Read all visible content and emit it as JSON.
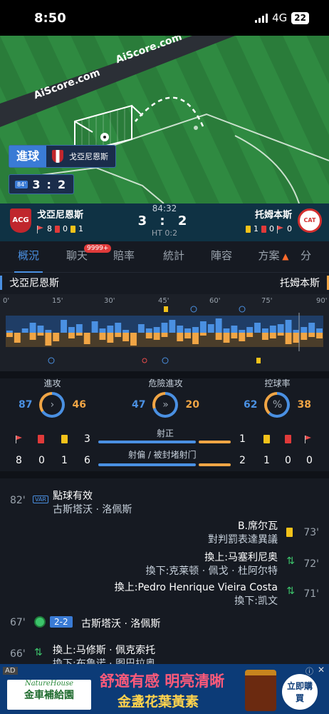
{
  "status_bar": {
    "time": "8:50",
    "network": "4G",
    "battery": "22"
  },
  "pitch": {
    "watermark": "AiScore.com",
    "goal_label": "進球",
    "goal_team": "戈亞尼恩斯",
    "minute_badge": "84'",
    "score_home": "3",
    "score_away": "2"
  },
  "match": {
    "home": {
      "name": "戈亞尼恩斯",
      "corners": "8",
      "reds": "0",
      "yellows": "1"
    },
    "away": {
      "name": "托姆本斯",
      "yellows": "1",
      "reds": "0",
      "corners": "0"
    },
    "clock": "84:32",
    "score": "3 : 2",
    "half_time": "HT 0:2"
  },
  "tabs": [
    {
      "label": "概況",
      "active": true
    },
    {
      "label": "聊天",
      "badge": "9999+"
    },
    {
      "label": "賠率"
    },
    {
      "label": "統計"
    },
    {
      "label": "陣容"
    },
    {
      "label": "方案"
    },
    {
      "label": "分"
    }
  ],
  "timeline": {
    "home_team": "戈亞尼恩斯",
    "away_team": "托姆本斯",
    "ticks": [
      "0'",
      "15'",
      "30'",
      "45'",
      "60'",
      "75'",
      "90'"
    ]
  },
  "stats": {
    "attack": {
      "label": "進攻",
      "home": "87",
      "away": "46"
    },
    "dangerous": {
      "label": "危險進攻",
      "home": "47",
      "away": "20"
    },
    "possession": {
      "label": "控球率",
      "home": "62",
      "away": "38",
      "symbol": "%"
    },
    "on_target": {
      "label": "射正",
      "home": "3",
      "away": "1"
    },
    "off_target": {
      "label": "射偏 / 被封堵射门",
      "home": "6",
      "away": "2"
    },
    "home_counts": {
      "corners": "8",
      "reds": "0",
      "yellows": "1"
    },
    "away_counts": {
      "yellows": "1",
      "reds": "0",
      "corners": "0"
    },
    "colors": {
      "home": "#4a90e2",
      "away": "#f0a545"
    }
  },
  "events": [
    {
      "minute": "82'",
      "side": "home",
      "type": "VAR",
      "title": "點球有效",
      "detail": "古斯塔沃 · 洛佩斯"
    },
    {
      "minute": "73'",
      "side": "away",
      "type": "yellow",
      "title": "B.席尔瓦",
      "detail": "對判罰表達異議"
    },
    {
      "minute": "72'",
      "side": "away",
      "type": "sub",
      "title": "換上:马塞利尼奥",
      "detail": "換下:克莱顿 · 佩戈 · 杜阿尔特"
    },
    {
      "minute": "71'",
      "side": "away",
      "type": "sub",
      "title": "換上:Pedro Henrique Vieira Costa",
      "detail": "換下:凯文"
    },
    {
      "minute": "67'",
      "side": "home",
      "type": "goal",
      "score": "2-2",
      "title": "古斯塔沃 · 洛佩斯"
    },
    {
      "minute": "66'",
      "side": "home",
      "type": "sub",
      "title": "換上:马修斯 · 佩克索托",
      "detail": "換下:布鲁诺 · 图巴拉奥"
    }
  ],
  "ad": {
    "tag": "AD",
    "brand": "NatureHouse",
    "brand_cn": "金車補給園",
    "line1": "舒適有感 明亮清晰",
    "line2": "金盞花葉黃素",
    "cta": "立即購買"
  }
}
